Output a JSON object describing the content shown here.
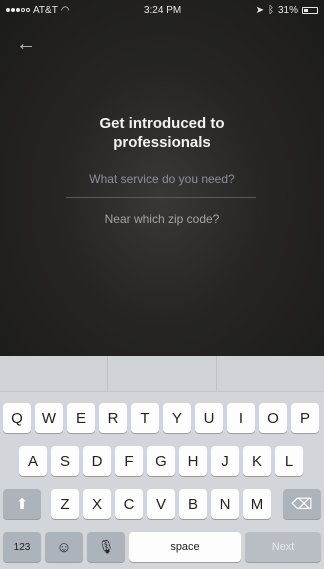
{
  "status_bar": {
    "carrier": "AT&T",
    "time": "3:24 PM",
    "battery": "31%"
  },
  "screen": {
    "back_icon": "back-arrow-icon",
    "headline": "Get introduced to professionals",
    "service_placeholder": "What service do you need?",
    "zip_placeholder": "Near which zip code?"
  },
  "keyboard": {
    "row1": [
      "Q",
      "W",
      "E",
      "R",
      "T",
      "Y",
      "U",
      "I",
      "O",
      "P"
    ],
    "row2": [
      "A",
      "S",
      "D",
      "F",
      "G",
      "H",
      "J",
      "K",
      "L"
    ],
    "row3": [
      "Z",
      "X",
      "C",
      "V",
      "B",
      "N",
      "M"
    ],
    "numbers_label": "123",
    "space_label": "space",
    "next_label": "Next",
    "icons": {
      "shift": "shift-icon",
      "delete": "delete-icon",
      "emoji": "emoji-icon",
      "mic": "microphone-icon"
    }
  }
}
